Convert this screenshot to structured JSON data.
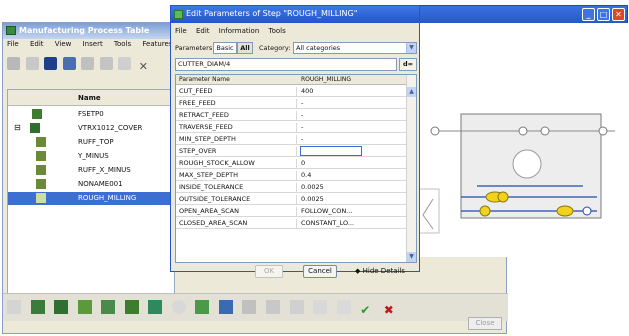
{
  "mpt": {
    "title": "Manufacturing Process Table",
    "menu": [
      "File",
      "Edit",
      "View",
      "Insert",
      "Tools",
      "Features"
    ],
    "tree_header": "Name",
    "rows": [
      {
        "label": "FSETP0",
        "icon": "fixture-icon"
      },
      {
        "label": "VTRX1012_COVER",
        "icon": "workpiece-icon"
      },
      {
        "label": "RUFF_TOP",
        "icon": "step-icon"
      },
      {
        "label": "Y_MINUS",
        "icon": "step-icon"
      },
      {
        "label": "RUFF_X_MINUS",
        "icon": "step-icon"
      },
      {
        "label": "NONAME001",
        "icon": "step-icon"
      },
      {
        "label": "ROUGH_MILLING",
        "icon": "step-icon",
        "selected": true
      }
    ],
    "close_label": "Close"
  },
  "dialog": {
    "title": "Edit Parameters of Step \"ROUGH_MILLING\"",
    "menu": [
      "File",
      "Edit",
      "Information",
      "Tools"
    ],
    "parameters_label": "Parameters:",
    "basic_label": "Basic",
    "all_label": "All",
    "category_label": "Category:",
    "category_value": "All categories",
    "expression": "CUTTER_DIAM/4",
    "dfx_label": "d=",
    "col_name": "Parameter Name",
    "col_value": "ROUGH_MILLING",
    "params": [
      {
        "name": "CUT_FEED",
        "value": "400"
      },
      {
        "name": "FREE_FEED",
        "value": "-"
      },
      {
        "name": "RETRACT_FEED",
        "value": "-"
      },
      {
        "name": "TRAVERSE_FEED",
        "value": "-"
      },
      {
        "name": "MIN_STEP_DEPTH",
        "value": "-"
      },
      {
        "name": "STEP_OVER",
        "value": "",
        "editing": true
      },
      {
        "name": "ROUGH_STOCK_ALLOW",
        "value": "0"
      },
      {
        "name": "MAX_STEP_DEPTH",
        "value": "0.4"
      },
      {
        "name": "INSIDE_TOLERANCE",
        "value": "0.0025"
      },
      {
        "name": "OUTSIDE_TOLERANCE",
        "value": "0.0025"
      },
      {
        "name": "OPEN_AREA_SCAN",
        "value": "FOLLOW_CON..."
      },
      {
        "name": "CLOSED_AREA_SCAN",
        "value": "CONSTANT_LO..."
      }
    ],
    "ok_label": "OK",
    "cancel_label": "Cancel",
    "hide_details_label": "Hide Details"
  },
  "colors": {
    "title_bar_blue": "#2555cc",
    "selection_blue": "#3d6fd1",
    "graph_line_blue": "#1f48b0",
    "graph_node_yellow": "#f3d21c"
  }
}
